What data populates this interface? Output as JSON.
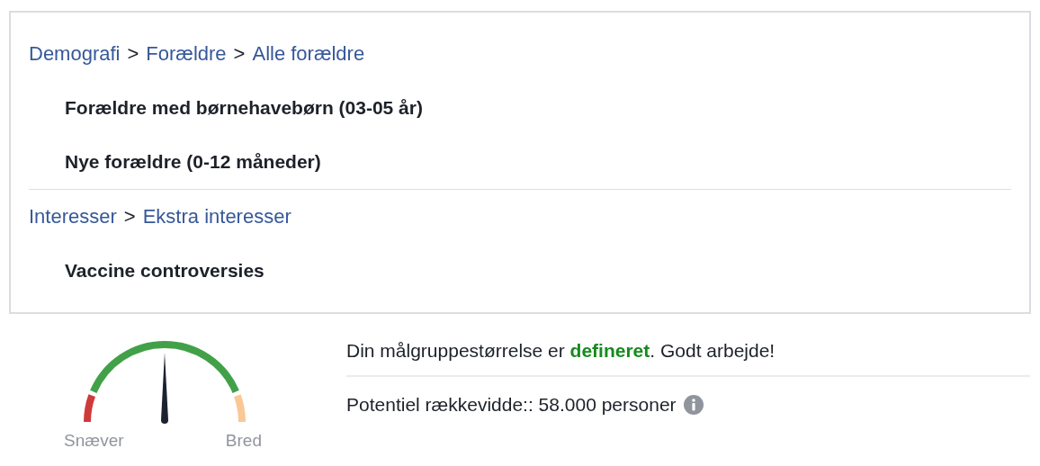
{
  "sections": [
    {
      "path": [
        {
          "label": "Demografi"
        },
        {
          "label": "Forældre"
        },
        {
          "label": "Alle forældre"
        }
      ],
      "separator": ">",
      "items": [
        "Forældre med børnehavebørn (03-05 år)",
        "Nye forældre (0-12 måneder)"
      ]
    },
    {
      "path": [
        {
          "label": "Interesser"
        },
        {
          "label": "Ekstra interesser"
        }
      ],
      "separator": ">",
      "items": [
        "Vaccine controversies"
      ]
    }
  ],
  "gauge": {
    "low_label": "Snæver",
    "high_label": "Bred"
  },
  "status": "Din målgruppestørrelse er **defineret**. Godt arbejde!",
  "reach": "Potentiel rækkevidde:: 58.000 personer"
}
